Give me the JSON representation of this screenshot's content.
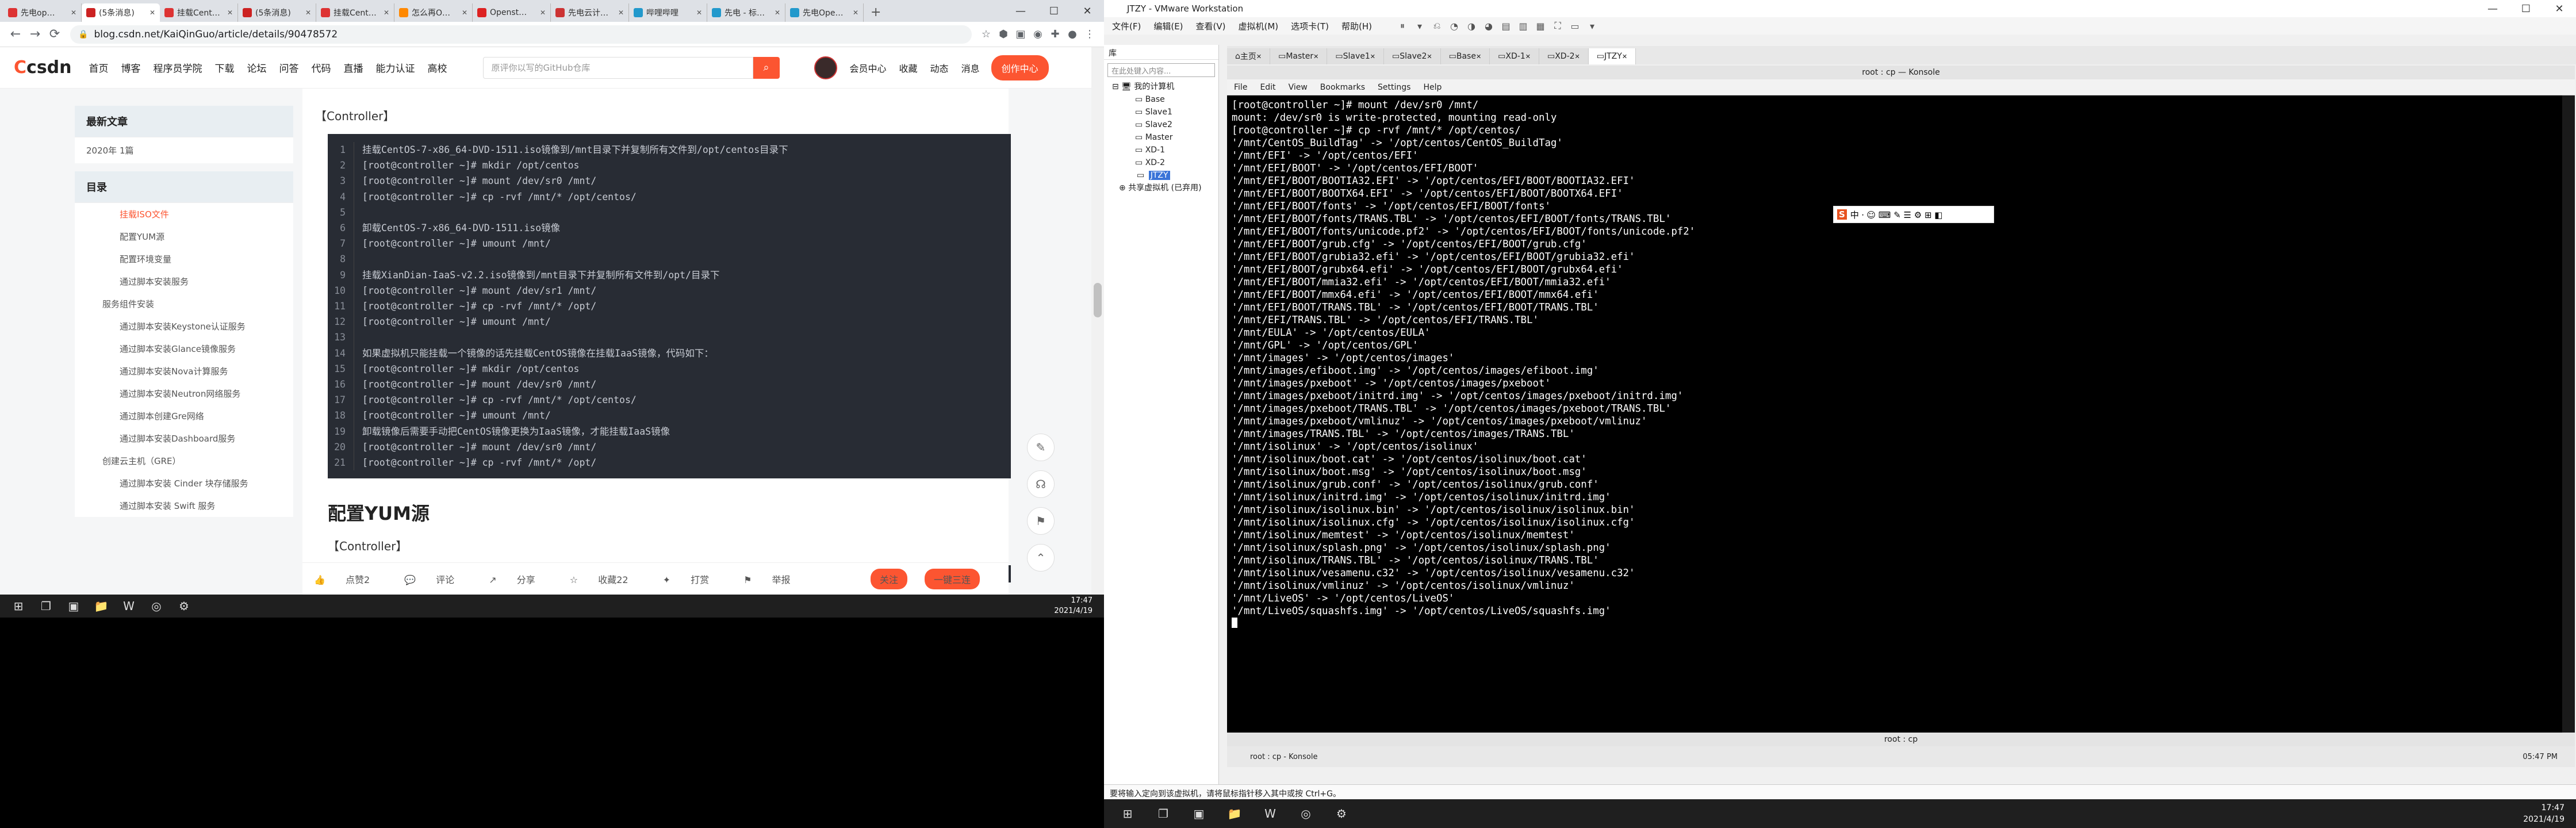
{
  "browser": {
    "tabs": [
      "先电op…",
      "(5条消息)",
      "挂载Cent…",
      "(5条消息)",
      "挂载Cent…",
      "怎么再O…",
      "Openst…",
      "先电云计…",
      "哔哩哔哩",
      "先电 - 标…",
      "先电Ope…"
    ],
    "url": "blog.csdn.net/KaiQinGuo/article/details/90478572"
  },
  "csdn": {
    "logo": "csdn",
    "nav": [
      "首页",
      "博客",
      "程序员学院",
      "下载",
      "论坛",
      "问答",
      "代码",
      "直播",
      "能力认证",
      "高校"
    ],
    "search_placeholder": "原评你以写的GitHub仓库",
    "right_nav": [
      "会员中心",
      "收藏",
      "动态",
      "消息"
    ],
    "create_label": "创作中心",
    "recent_title": "最新文章",
    "recent_item": "2020年 1篇",
    "toc_title": "目录",
    "toc": [
      {
        "text": "挂载ISO文件",
        "level": 2,
        "active": true
      },
      {
        "text": "配置YUM源",
        "level": 2
      },
      {
        "text": "配置环境变量",
        "level": 2
      },
      {
        "text": "通过脚本安装服务",
        "level": 2
      },
      {
        "text": "服务组件安装",
        "level": 1
      },
      {
        "text": "通过脚本安装Keystone认证服务",
        "level": 2
      },
      {
        "text": "通过脚本安装Glance镜像服务",
        "level": 2
      },
      {
        "text": "通过脚本安装Nova计算服务",
        "level": 2
      },
      {
        "text": "通过脚本安装Neutron网络服务",
        "level": 2
      },
      {
        "text": "通过脚本创建Gre网络",
        "level": 2
      },
      {
        "text": "通过脚本安装Dashboard服务",
        "level": 2
      },
      {
        "text": "创建云主机（GRE）",
        "level": 1
      },
      {
        "text": "通过脚本安装 Cinder 块存储服务",
        "level": 2
      },
      {
        "text": "通过脚本安装 Swift 服务",
        "level": 2
      }
    ],
    "section_label": "【Controller】",
    "code": [
      "挂载CentOS-7-x86_64-DVD-1511.iso镜像到/mnt目录下并复制所有文件到/opt/centos目录下",
      "[root@controller ~]# mkdir /opt/centos",
      "[root@controller ~]# mount /dev/sr0 /mnt/",
      "[root@controller ~]# cp -rvf /mnt/* /opt/centos/",
      "",
      "卸载CentOS-7-x86_64-DVD-1511.iso镜像",
      "[root@controller ~]# umount /mnt/",
      "",
      "挂载XianDian-IaaS-v2.2.iso镜像到/mnt目录下并复制所有文件到/opt/目录下",
      "[root@controller ~]# mount /dev/sr1 /mnt/",
      "[root@controller ~]# cp -rvf /mnt/* /opt/",
      "[root@controller ~]# umount /mnt/",
      "",
      "如果虚拟机只能挂载一个镜像的话先挂载CentOS镜像在挂载IaaS镜像，代码如下：",
      "[root@controller ~]# mkdir /opt/centos",
      "[root@controller ~]# mount /dev/sr0 /mnt/",
      "[root@controller ~]# cp -rvf /mnt/* /opt/centos/",
      "[root@controller ~]# umount /mnt/",
      "卸载镜像后需要手动把CentOS镜像更换为IaaS镜像，才能挂载IaaS镜像",
      "[root@controller ~]# mount /dev/sr0 /mnt/",
      "[root@controller ~]# cp -rvf /mnt/* /opt/"
    ],
    "heading2": "配置YUM源",
    "section_label2": "【Controller】",
    "actions": [
      "点赞2",
      "评论",
      "分享",
      "收藏22",
      "打赏",
      "举报"
    ],
    "follow_label": "关注",
    "onekey_label": "一键三连"
  },
  "taskbar_left": {
    "time": "17:47",
    "date": "2021/4/19"
  },
  "vmware": {
    "title": "JTZY - VMware Workstation",
    "menu": [
      "文件(F)",
      "编辑(E)",
      "查看(V)",
      "虚拟机(M)",
      "选项卡(T)",
      "帮助(H)"
    ],
    "library_title": "库",
    "library_search": "在此处键入内容...",
    "tree_root": "我的计算机",
    "vms": [
      "Base",
      "Slave1",
      "Slave2",
      "Master",
      "XD-1",
      "XD-2",
      "JTZY"
    ],
    "shared": "共享虚拟机 (已弃用)",
    "tabs": [
      "主页",
      "Master",
      "Slave1",
      "Slave2",
      "Base",
      "XD-1",
      "XD-2",
      "JTZY"
    ],
    "status_text": "要将输入定向到该虚拟机，请将鼠标指针移入其中或按 Ctrl+G。"
  },
  "konsole": {
    "title": "root : cp — Konsole",
    "menu": [
      "File",
      "Edit",
      "View",
      "Bookmarks",
      "Settings",
      "Help"
    ],
    "status": "root : cp",
    "task_label": "root : cp - Konsole",
    "clock": "05:47 PM",
    "lines": [
      "[root@controller ~]# mount /dev/sr0 /mnt/",
      "mount: /dev/sr0 is write-protected, mounting read-only",
      "[root@controller ~]# cp -rvf /mnt/* /opt/centos/",
      "'/mnt/CentOS_BuildTag' -> '/opt/centos/CentOS_BuildTag'",
      "'/mnt/EFI' -> '/opt/centos/EFI'",
      "'/mnt/EFI/BOOT' -> '/opt/centos/EFI/BOOT'",
      "'/mnt/EFI/BOOT/BOOTIA32.EFI' -> '/opt/centos/EFI/BOOT/BOOTIA32.EFI'",
      "'/mnt/EFI/BOOT/BOOTX64.EFI' -> '/opt/centos/EFI/BOOT/BOOTX64.EFI'",
      "'/mnt/EFI/BOOT/fonts' -> '/opt/centos/EFI/BOOT/fonts'",
      "'/mnt/EFI/BOOT/fonts/TRANS.TBL' -> '/opt/centos/EFI/BOOT/fonts/TRANS.TBL'",
      "'/mnt/EFI/BOOT/fonts/unicode.pf2' -> '/opt/centos/EFI/BOOT/fonts/unicode.pf2'",
      "'/mnt/EFI/BOOT/grub.cfg' -> '/opt/centos/EFI/BOOT/grub.cfg'",
      "'/mnt/EFI/BOOT/grubia32.efi' -> '/opt/centos/EFI/BOOT/grubia32.efi'",
      "'/mnt/EFI/BOOT/grubx64.efi' -> '/opt/centos/EFI/BOOT/grubx64.efi'",
      "'/mnt/EFI/BOOT/mmia32.efi' -> '/opt/centos/EFI/BOOT/mmia32.efi'",
      "'/mnt/EFI/BOOT/mmx64.efi' -> '/opt/centos/EFI/BOOT/mmx64.efi'",
      "'/mnt/EFI/BOOT/TRANS.TBL' -> '/opt/centos/EFI/BOOT/TRANS.TBL'",
      "'/mnt/EFI/TRANS.TBL' -> '/opt/centos/EFI/TRANS.TBL'",
      "'/mnt/EULA' -> '/opt/centos/EULA'",
      "'/mnt/GPL' -> '/opt/centos/GPL'",
      "'/mnt/images' -> '/opt/centos/images'",
      "'/mnt/images/efiboot.img' -> '/opt/centos/images/efiboot.img'",
      "'/mnt/images/pxeboot' -> '/opt/centos/images/pxeboot'",
      "'/mnt/images/pxeboot/initrd.img' -> '/opt/centos/images/pxeboot/initrd.img'",
      "'/mnt/images/pxeboot/TRANS.TBL' -> '/opt/centos/images/pxeboot/TRANS.TBL'",
      "'/mnt/images/pxeboot/vmlinuz' -> '/opt/centos/images/pxeboot/vmlinuz'",
      "'/mnt/images/TRANS.TBL' -> '/opt/centos/images/TRANS.TBL'",
      "'/mnt/isolinux' -> '/opt/centos/isolinux'",
      "'/mnt/isolinux/boot.cat' -> '/opt/centos/isolinux/boot.cat'",
      "'/mnt/isolinux/boot.msg' -> '/opt/centos/isolinux/boot.msg'",
      "'/mnt/isolinux/grub.conf' -> '/opt/centos/isolinux/grub.conf'",
      "'/mnt/isolinux/initrd.img' -> '/opt/centos/isolinux/initrd.img'",
      "'/mnt/isolinux/isolinux.bin' -> '/opt/centos/isolinux/isolinux.bin'",
      "'/mnt/isolinux/isolinux.cfg' -> '/opt/centos/isolinux/isolinux.cfg'",
      "'/mnt/isolinux/memtest' -> '/opt/centos/isolinux/memtest'",
      "'/mnt/isolinux/splash.png' -> '/opt/centos/isolinux/splash.png'",
      "'/mnt/isolinux/TRANS.TBL' -> '/opt/centos/isolinux/TRANS.TBL'",
      "'/mnt/isolinux/vesamenu.c32' -> '/opt/centos/isolinux/vesamenu.c32'",
      "'/mnt/isolinux/vmlinuz' -> '/opt/centos/isolinux/vmlinuz'",
      "'/mnt/LiveOS' -> '/opt/centos/LiveOS'",
      "'/mnt/LiveOS/squashfs.img' -> '/opt/centos/LiveOS/squashfs.img'"
    ]
  },
  "taskbar_right": {
    "time": "17:47",
    "date": "2021/4/19"
  }
}
